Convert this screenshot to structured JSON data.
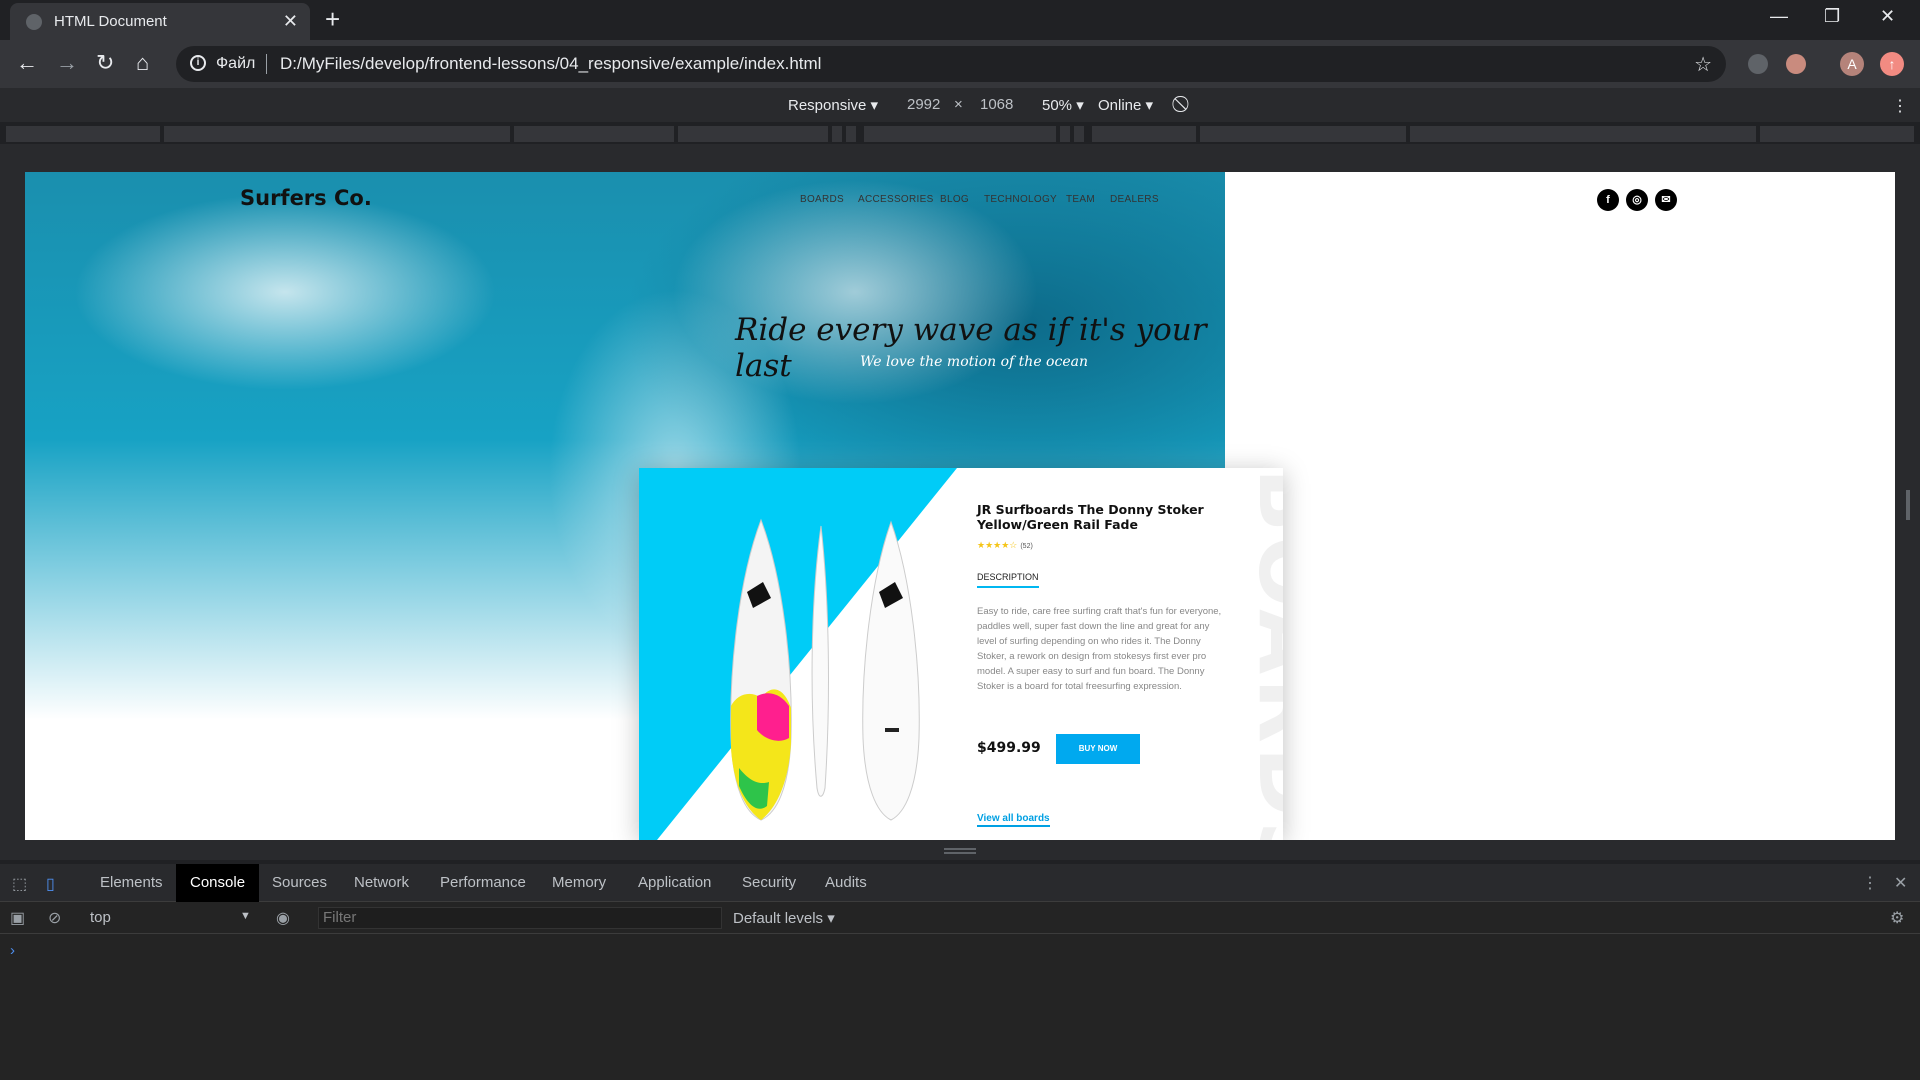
{
  "browser": {
    "tab_title": "HTML Document",
    "tab_close": "✕",
    "new_tab": "+",
    "window_controls": [
      "—",
      "❐",
      "✕"
    ],
    "address": {
      "protocol_label": "Файл",
      "url": "D:/MyFiles/develop/frontend-lessons/04_responsive/example/index.html"
    },
    "avatar_letter": "A"
  },
  "device_toolbar": {
    "device": "Responsive",
    "width": "2992",
    "times": "×",
    "height": "1068",
    "zoom": "50%",
    "network": "Online"
  },
  "site": {
    "logo": "Surfers Co.",
    "nav": [
      "BOARDS",
      "ACCESSORIES",
      "BLOG",
      "TECHNOLOGY",
      "TEAM",
      "DEALERS"
    ],
    "social": [
      {
        "icon": "facebook-icon",
        "glyph": "f"
      },
      {
        "icon": "instagram-icon",
        "glyph": "◎"
      },
      {
        "icon": "mail-icon",
        "glyph": "✉"
      }
    ],
    "tagline": "Ride every wave as if it's your last",
    "subtagline": "We love the motion of the ocean",
    "product": {
      "title": "JR Surfboards The Donny Stoker Yellow/Green Rail Fade",
      "rating_stars": "★★★★☆",
      "rating": 4,
      "review_count": "(52)",
      "tab": "DESCRIPTION",
      "description": "Easy to ride, care free surfing craft that's fun for everyone, paddles well, super fast down the line and great for any level of surfing depending on who rides it. The Donny Stoker, a rework on design from stokesys first ever pro model. A super easy to surf and fun board. The Donny Stoker is a board for total freesurfing expression.",
      "price": "$499.99",
      "buy_label": "BUY NOW",
      "view_all": "View all boards",
      "watermark": "BOARDS"
    },
    "colors": {
      "accent": "#00a9ef",
      "card_triangle": "#00ccf7"
    }
  },
  "devtools": {
    "tabs": [
      "Elements",
      "Console",
      "Sources",
      "Network",
      "Performance",
      "Memory",
      "Application",
      "Security",
      "Audits"
    ],
    "active_tab": "Console",
    "context": "top",
    "filter_placeholder": "Filter",
    "levels": "Default levels",
    "prompt": "›"
  }
}
